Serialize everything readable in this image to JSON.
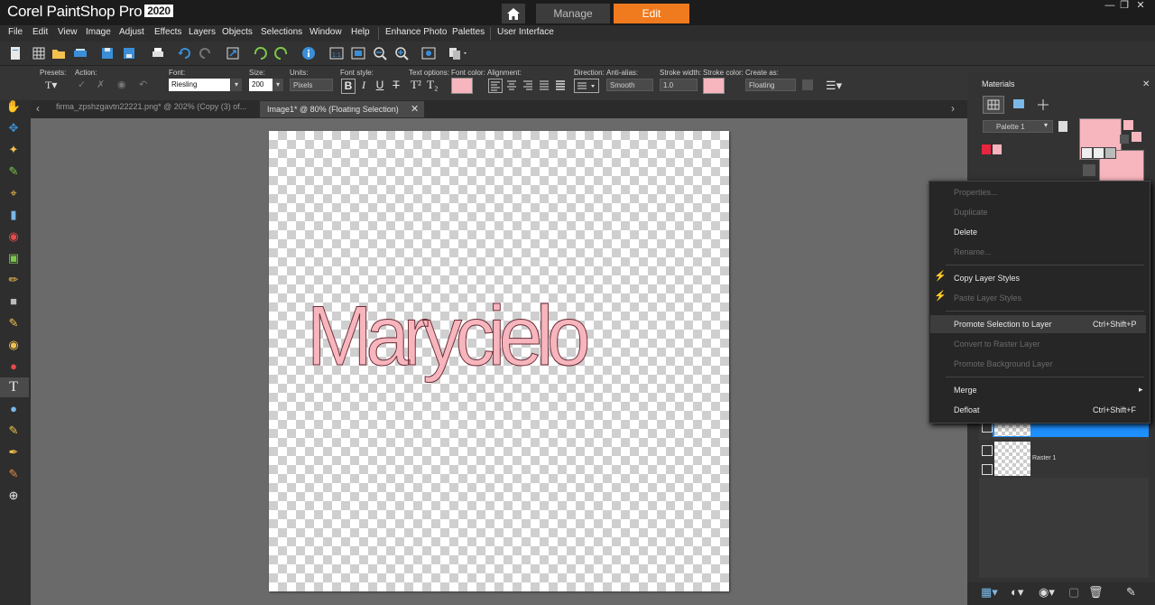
{
  "app": {
    "title": "Corel PaintShop Pro",
    "year": "2020"
  },
  "modes": {
    "manage": "Manage",
    "edit": "Edit"
  },
  "menu": [
    "File",
    "Edit",
    "View",
    "Image",
    "Adjust",
    "Effects",
    "Layers",
    "Objects",
    "Selections",
    "Window",
    "Help",
    "Enhance Photo",
    "Palettes",
    "User Interface"
  ],
  "options": {
    "presets_label": "Presets:",
    "action_label": "Action:",
    "font_label": "Font:",
    "font_value": "Riesling",
    "size_label": "Size:",
    "size_value": "200",
    "units_label": "Units:",
    "units_value": "Pixels",
    "font_style_label": "Font style:",
    "text_options_label": "Text options:",
    "font_color_label": "Font color:",
    "alignment_label": "Alignment:",
    "direction_label": "Direction:",
    "antialias_label": "Anti-alias:",
    "antialias_value": "Smooth",
    "stroke_width_label": "Stroke width:",
    "stroke_width_value": "1.0",
    "stroke_color_label": "Stroke color:",
    "create_as_label": "Create as:",
    "create_as_value": "Floating",
    "bold": "B",
    "italic": "I",
    "underline": "U",
    "strike": "T"
  },
  "tabs": [
    {
      "label": "firma_zpshzgavtn22221.png* @ 202% (Copy (3) of..."
    },
    {
      "label": "Image1* @  80% (Floating Selection)"
    }
  ],
  "canvas": {
    "text": "Marycielo"
  },
  "materials": {
    "title": "Materials",
    "palette": "Palette 1"
  },
  "layers": {
    "raster_name": "Raster 1"
  },
  "context_menu": {
    "items": [
      {
        "label": "Properties...",
        "enabled": false
      },
      {
        "label": "Duplicate",
        "enabled": false
      },
      {
        "label": "Delete",
        "enabled": true
      },
      {
        "label": "Rename...",
        "enabled": false
      },
      {
        "label": "Copy Layer Styles",
        "enabled": true
      },
      {
        "label": "Paste Layer Styles",
        "enabled": false
      },
      {
        "label": "Promote Selection to Layer",
        "enabled": true,
        "shortcut": "Ctrl+Shift+P"
      },
      {
        "label": "Convert to Raster Layer",
        "enabled": false
      },
      {
        "label": "Promote Background Layer",
        "enabled": false
      },
      {
        "label": "Merge",
        "enabled": true
      },
      {
        "label": "Defloat",
        "enabled": true,
        "shortcut": "Ctrl+Shift+F"
      }
    ]
  },
  "colors": {
    "accent": "#f07a1e",
    "font_color": "#f7b5bd",
    "selection_blue": "#1e90ff",
    "red_swatch": "#e8253f"
  }
}
